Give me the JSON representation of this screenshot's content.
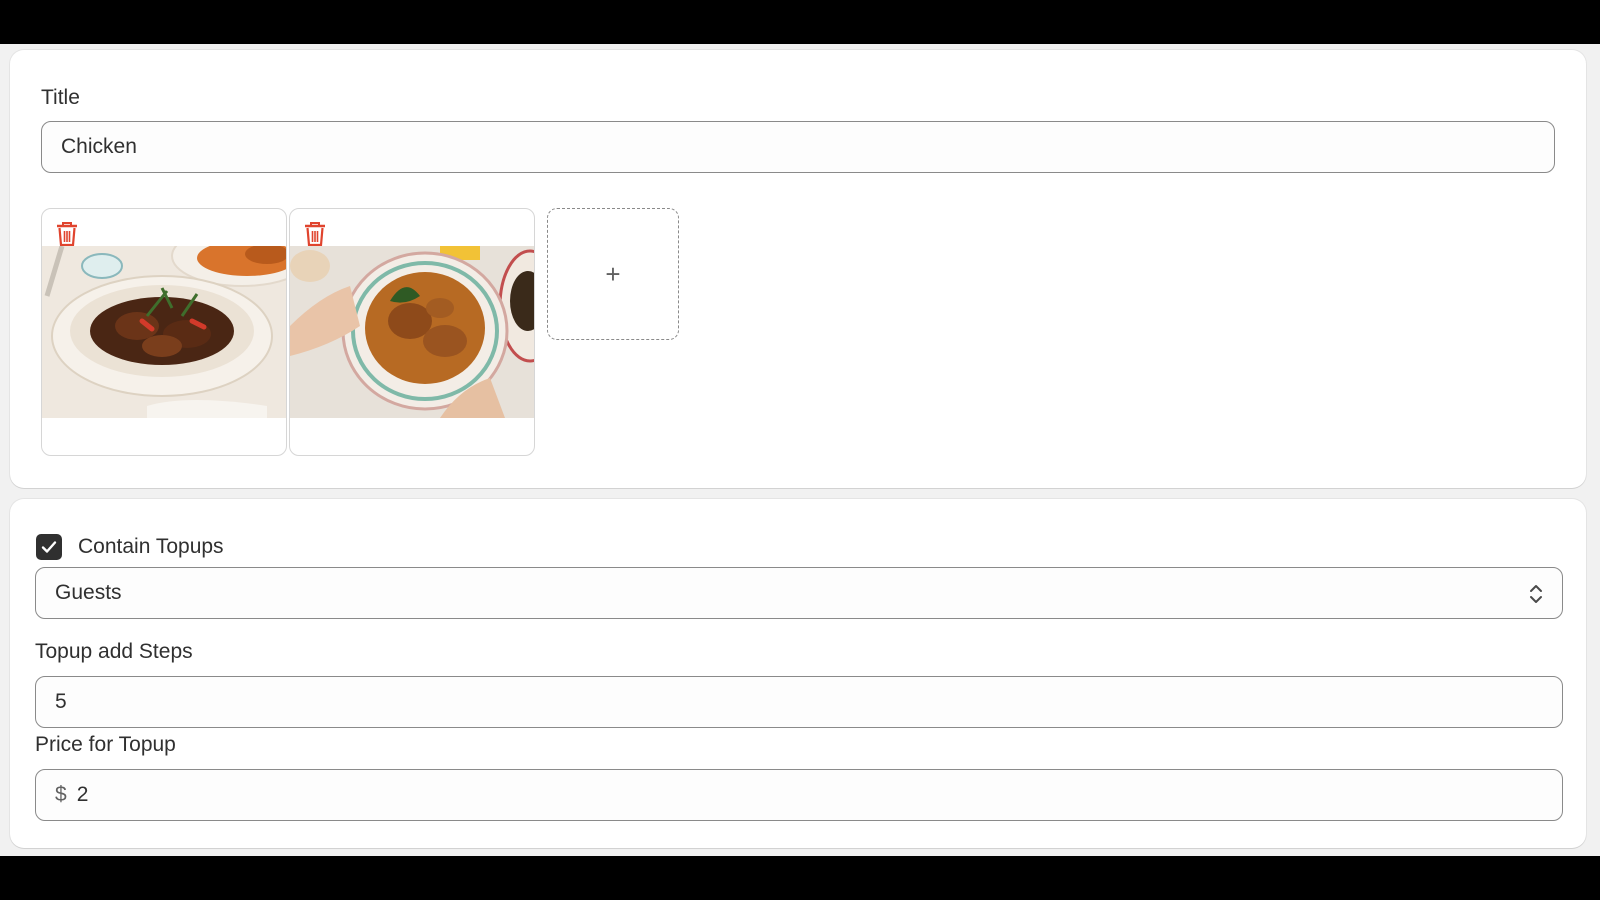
{
  "title_field": {
    "label": "Title",
    "value": "Chicken"
  },
  "media": {
    "images": [
      {
        "alt": "braised chicken in bowl",
        "delete_icon": "trash-icon"
      },
      {
        "alt": "chicken curry in bowl",
        "delete_icon": "trash-icon"
      }
    ],
    "add_glyph": "+"
  },
  "topups": {
    "checkbox_label": "Contain Topups",
    "checked": true,
    "select_value": "Guests",
    "steps_label": "Topup add Steps",
    "steps_value": "5",
    "price_label": "Price for Topup",
    "price_prefix": "$",
    "price_value": "2"
  },
  "colors": {
    "delete_icon": "#e0442e",
    "checkbox": "#303030"
  }
}
